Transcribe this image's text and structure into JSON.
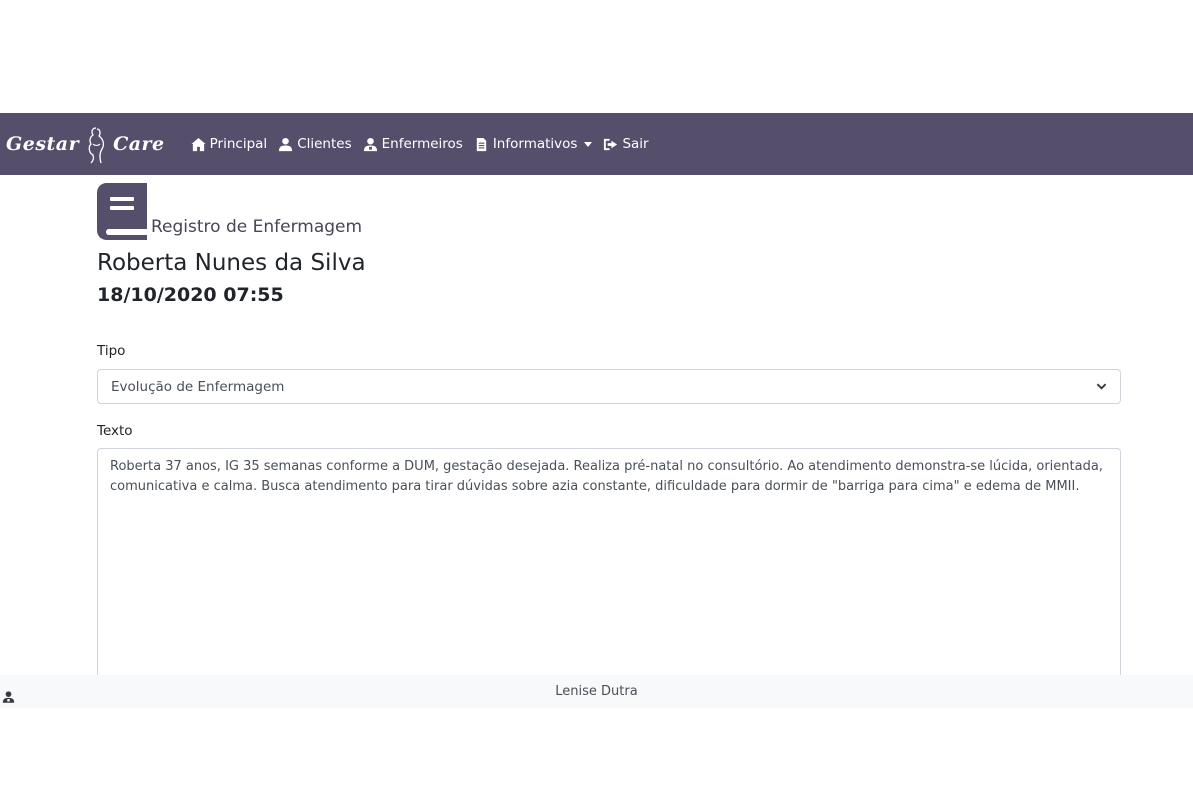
{
  "navbar": {
    "brand_left": "Gestar",
    "brand_right": "Care",
    "items": [
      {
        "label": "Principal",
        "icon": "home-icon"
      },
      {
        "label": "Clientes",
        "icon": "user-icon"
      },
      {
        "label": "Enfermeiros",
        "icon": "nurse-icon"
      },
      {
        "label": "Informativos",
        "icon": "document-icon"
      },
      {
        "label": "Sair",
        "icon": "sign-out-icon"
      }
    ]
  },
  "record": {
    "section_title": "Registro de Enfermagem",
    "patient_name": "Roberta Nunes da Silva",
    "datetime": "18/10/2020 07:55"
  },
  "form": {
    "tipo_label": "Tipo",
    "tipo_value": "Evolução de Enfermagem",
    "texto_label": "Texto",
    "texto_value": "Roberta 37 anos, IG 35 semanas conforme a DUM, gestação desejada. Realiza pré-natal no consultório. Ao atendimento demonstra-se lúcida, orientada, comunicativa e calma. Busca atendimento para tirar dúvidas sobre azia constante, dificuldade para dormir de \"barriga para cima\" e edema de MMII."
  },
  "footer": {
    "user_name": "Lenise Dutra"
  },
  "colors": {
    "navbar_bg": "#564f6b",
    "icon_accent": "#564f6b"
  }
}
